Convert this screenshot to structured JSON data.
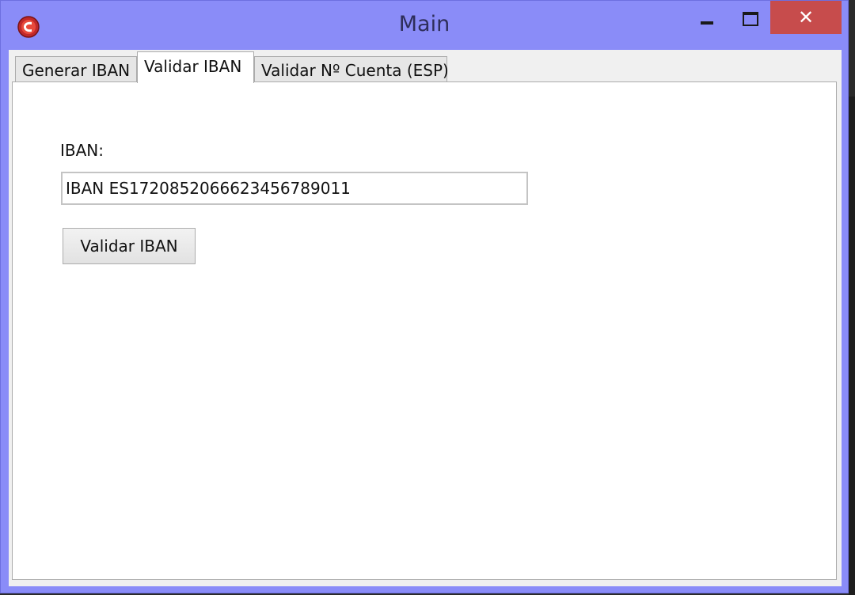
{
  "window": {
    "title": "Main",
    "close_glyph": "✕",
    "app_icon": "app-logo-icon",
    "close_color": "#c74c4c",
    "frame_color": "#8a8cf8"
  },
  "tabs": [
    {
      "label": "Generar IBAN",
      "active": false
    },
    {
      "label": "Validar IBAN",
      "active": true
    },
    {
      "label": "Validar Nº Cuenta (ESP)",
      "active": false
    }
  ],
  "form": {
    "iban_label": "IBAN:",
    "iban_value": "IBAN ES1720852066623456789011",
    "validate_button": "Validar IBAN"
  }
}
